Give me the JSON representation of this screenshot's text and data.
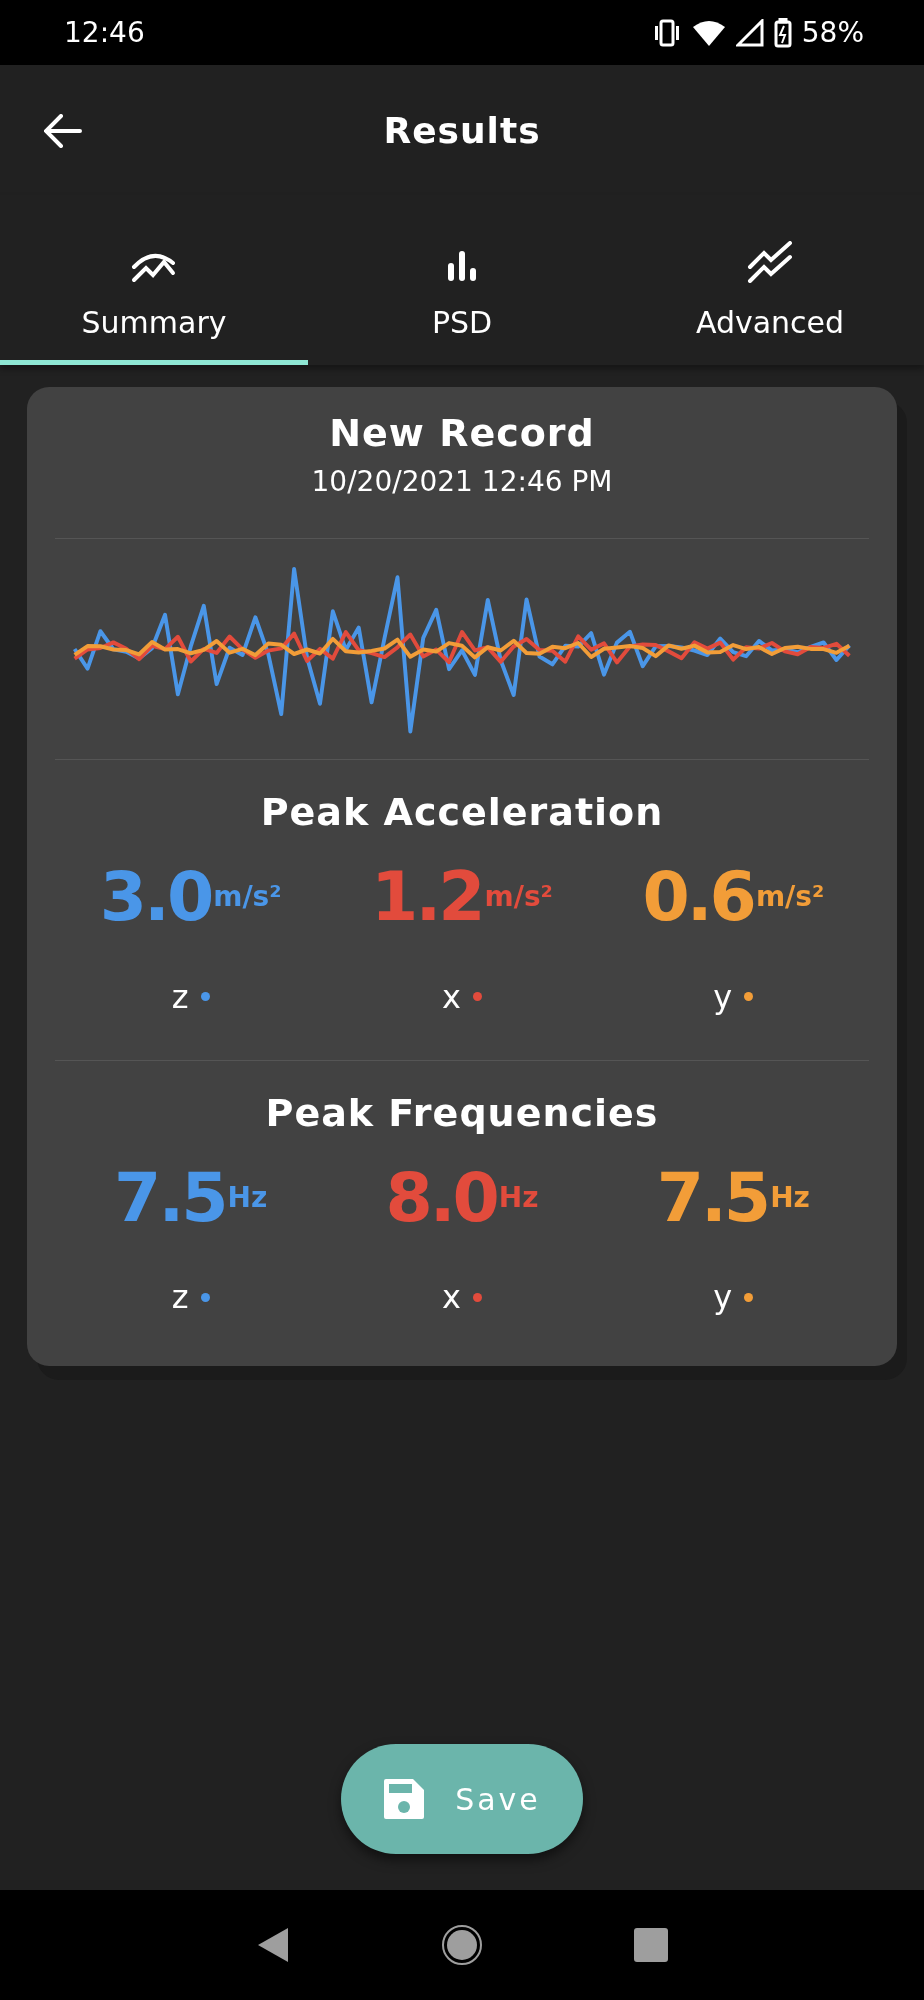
{
  "status_bar": {
    "time": "12:46",
    "battery": "58%"
  },
  "header": {
    "title": "Results"
  },
  "tabs": [
    {
      "label": "Summary",
      "selected": true
    },
    {
      "label": "PSD",
      "selected": false
    },
    {
      "label": "Advanced",
      "selected": false
    }
  ],
  "record": {
    "title": "New Record",
    "date": "10/20/2021 12:46 PM",
    "traces": [
      {
        "color": "#4a96e8"
      },
      {
        "color": "#e24b3c"
      },
      {
        "color": "#f29d38"
      }
    ]
  },
  "sections": [
    {
      "title": "Peak Acceleration",
      "metrics": [
        {
          "value": "3.0",
          "unit": "m/s²",
          "axis": "z",
          "color": "#4a96e8"
        },
        {
          "value": "1.2",
          "unit": "m/s²",
          "axis": "x",
          "color": "#e24b3c"
        },
        {
          "value": "0.6",
          "unit": "m/s²",
          "axis": "y",
          "color": "#f29d38"
        }
      ]
    },
    {
      "title": "Peak Frequencies",
      "metrics": [
        {
          "value": "7.5",
          "unit": "Hz",
          "axis": "z",
          "color": "#4a96e8"
        },
        {
          "value": "8.0",
          "unit": "Hz",
          "axis": "x",
          "color": "#e24b3c"
        },
        {
          "value": "7.5",
          "unit": "Hz",
          "axis": "y",
          "color": "#f29d38"
        }
      ]
    }
  ],
  "save_button": {
    "label": "Save"
  }
}
